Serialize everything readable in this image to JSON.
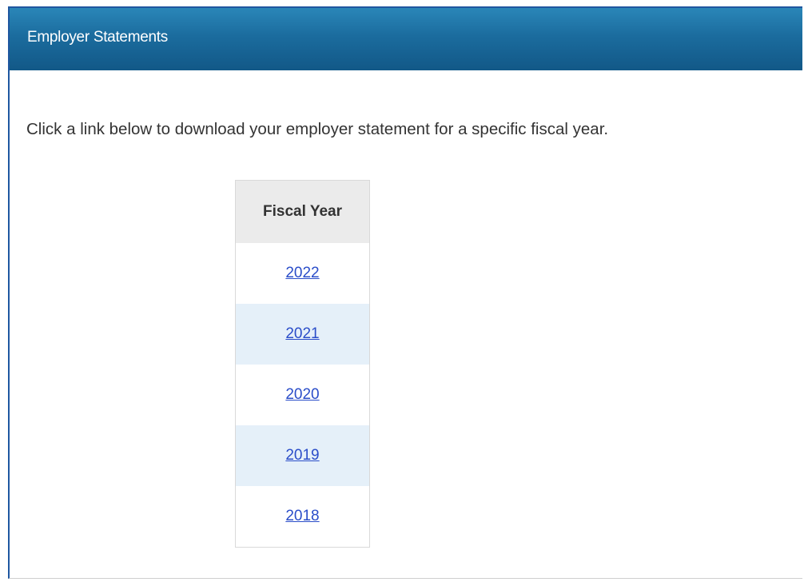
{
  "panel": {
    "title": "Employer Statements"
  },
  "instructions": "Click a link below to download your employer statement for a specific fiscal year.",
  "table": {
    "header": "Fiscal Year",
    "rows": [
      {
        "year": "2022"
      },
      {
        "year": "2021"
      },
      {
        "year": "2020"
      },
      {
        "year": "2019"
      },
      {
        "year": "2018"
      }
    ]
  },
  "colors": {
    "header_bg": "#1b6c9e",
    "link": "#2a4dc9",
    "alt_row": "#e5f0f9"
  }
}
